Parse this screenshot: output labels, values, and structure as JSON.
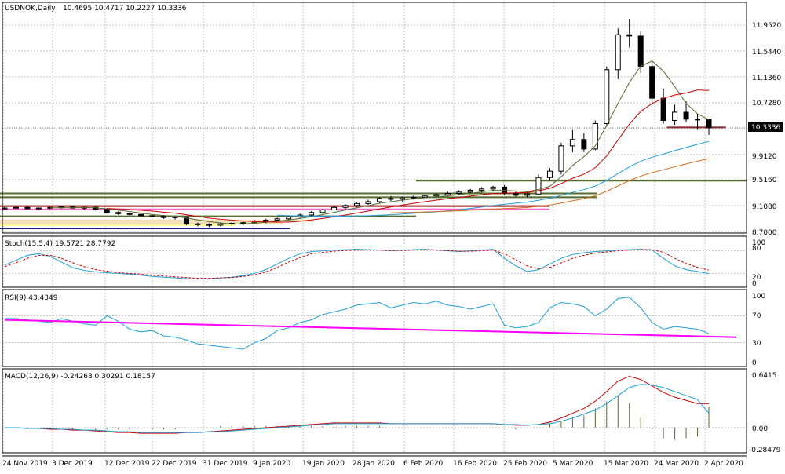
{
  "colors": {
    "bull": "#ffffff",
    "bear": "#000000",
    "grid": "#c0c0c0",
    "frame": "#000000",
    "ma_fast": "#556b2f",
    "ma_mid": "#cc0000",
    "ma_slow": "#1e9ed6",
    "ma_long": "#d2691e",
    "stoch_main": "#1e9ed6",
    "stoch_signal": "#cc0000",
    "rsi": "#1e9ed6",
    "rsi_ma": "#ff00ff",
    "macd_hist": "#556b2f",
    "macd_main": "#cc0000",
    "macd_signal": "#1e9ed6",
    "price_line": "#708090"
  },
  "main": {
    "symbol": "USDNOK,Daily",
    "ohlc": "10.4695 10.4717 10.2227 10.3336",
    "current_price": "10.3336",
    "ticks": [
      "11.9520",
      "11.5440",
      "11.1360",
      "10.7280",
      "9.9120",
      "9.5160",
      "9.1080",
      "8.7000"
    ]
  },
  "stoch": {
    "title": "Stoch(15,5,4) 19.5721 28.7792",
    "top": "100",
    "ticks": [
      "80",
      "20",
      "0"
    ]
  },
  "rsi": {
    "title": "RSI(9) 43.4349",
    "ticks": [
      "100",
      "70",
      "30",
      "0"
    ]
  },
  "macd": {
    "title": "MACD(12,26,9) -0.24268 0.30291 0.18157",
    "ticks": [
      "0.6415",
      "0.00",
      "-0.28479"
    ]
  },
  "x_labels": [
    "24 Nov 2019",
    "3 Dec 2019",
    "12 Dec 2019",
    "22 Dec 2019",
    "31 Dec 2019",
    "9 Jan 2020",
    "19 Jan 2020",
    "28 Jan 2020",
    "6 Feb 2020",
    "16 Feb 2020",
    "25 Feb 2020",
    "5 Mar 2020",
    "15 Mar 2020",
    "24 Mar 2020",
    "2 Apr 2020"
  ],
  "chart_data": {
    "type": "candlestick",
    "instrument": "USDNOK",
    "timeframe": "Daily",
    "price_ticks": [
      11.952,
      11.544,
      11.136,
      10.728,
      9.912,
      9.516,
      9.108,
      8.7
    ],
    "ohlc": [
      [
        9.06,
        9.09,
        9.04,
        9.07
      ],
      [
        9.07,
        9.09,
        9.05,
        9.08
      ],
      [
        9.08,
        9.1,
        9.05,
        9.06
      ],
      [
        9.06,
        9.08,
        9.04,
        9.07
      ],
      [
        9.07,
        9.09,
        9.05,
        9.08
      ],
      [
        9.08,
        9.1,
        9.06,
        9.09
      ],
      [
        9.09,
        9.11,
        9.06,
        9.07
      ],
      [
        9.07,
        9.09,
        9.04,
        9.08
      ],
      [
        9.08,
        9.09,
        9.03,
        9.05
      ],
      [
        9.05,
        9.06,
        8.98,
        9.0
      ],
      [
        9.0,
        9.02,
        8.96,
        8.98
      ],
      [
        8.98,
        9.0,
        8.95,
        8.97
      ],
      [
        8.97,
        8.98,
        8.93,
        8.95
      ],
      [
        8.95,
        8.96,
        8.92,
        8.94
      ],
      [
        8.94,
        8.96,
        8.9,
        8.92
      ],
      [
        8.92,
        8.94,
        8.89,
        8.93
      ],
      [
        8.93,
        8.94,
        8.8,
        8.82
      ],
      [
        8.82,
        8.84,
        8.78,
        8.81
      ],
      [
        8.81,
        8.83,
        8.77,
        8.8
      ],
      [
        8.8,
        8.83,
        8.78,
        8.82
      ],
      [
        8.82,
        8.85,
        8.79,
        8.83
      ],
      [
        8.83,
        8.86,
        8.8,
        8.84
      ],
      [
        8.84,
        8.88,
        8.82,
        8.86
      ],
      [
        8.86,
        8.9,
        8.83,
        8.88
      ],
      [
        8.88,
        8.92,
        8.86,
        8.9
      ],
      [
        8.9,
        8.95,
        8.88,
        8.93
      ],
      [
        8.93,
        8.98,
        8.91,
        8.96
      ],
      [
        8.96,
        9.02,
        8.94,
        9.0
      ],
      [
        9.0,
        9.06,
        8.98,
        9.04
      ],
      [
        9.04,
        9.1,
        9.02,
        9.08
      ],
      [
        9.08,
        9.13,
        9.05,
        9.11
      ],
      [
        9.11,
        9.16,
        9.08,
        9.14
      ],
      [
        9.14,
        9.2,
        9.12,
        9.17
      ],
      [
        9.17,
        9.24,
        9.14,
        9.22
      ],
      [
        9.22,
        9.26,
        9.18,
        9.21
      ],
      [
        9.21,
        9.25,
        9.17,
        9.23
      ],
      [
        9.23,
        9.27,
        9.2,
        9.24
      ],
      [
        9.24,
        9.28,
        9.2,
        9.26
      ],
      [
        9.26,
        9.3,
        9.23,
        9.28
      ],
      [
        9.28,
        9.33,
        9.25,
        9.3
      ],
      [
        9.3,
        9.35,
        9.27,
        9.32
      ],
      [
        9.32,
        9.37,
        9.29,
        9.35
      ],
      [
        9.35,
        9.4,
        9.31,
        9.37
      ],
      [
        9.37,
        9.42,
        9.33,
        9.4
      ],
      [
        9.4,
        9.43,
        9.27,
        9.3
      ],
      [
        9.3,
        9.33,
        9.25,
        9.27
      ],
      [
        9.27,
        9.32,
        9.24,
        9.29
      ],
      [
        9.29,
        9.6,
        9.28,
        9.55
      ],
      [
        9.55,
        9.7,
        9.5,
        9.65
      ],
      [
        9.65,
        10.1,
        9.6,
        10.05
      ],
      [
        10.05,
        10.3,
        9.95,
        10.15
      ],
      [
        10.15,
        10.25,
        9.95,
        10.0
      ],
      [
        10.0,
        10.45,
        9.98,
        10.4
      ],
      [
        10.4,
        11.3,
        10.35,
        11.25
      ],
      [
        11.25,
        11.9,
        11.1,
        11.8
      ],
      [
        11.8,
        12.05,
        11.6,
        11.78
      ],
      [
        11.78,
        11.85,
        11.2,
        11.3
      ],
      [
        11.3,
        11.4,
        10.7,
        10.8
      ],
      [
        10.8,
        10.95,
        10.4,
        10.45
      ],
      [
        10.45,
        10.7,
        10.38,
        10.58
      ],
      [
        10.58,
        10.75,
        10.42,
        10.47
      ],
      [
        10.47,
        10.55,
        10.3,
        10.4695
      ],
      [
        10.4695,
        10.4717,
        10.2227,
        10.3336
      ]
    ],
    "moving_averages": [
      {
        "name": "",
        "color": "#556b2f",
        "last": 10.55
      },
      {
        "name": "",
        "color": "#cc0000",
        "last": 10.85
      },
      {
        "name": "",
        "color": "#1e9ed6",
        "last": 9.85
      },
      {
        "name": "",
        "color": "#d2691e",
        "last": 9.66
      }
    ],
    "indicators": {
      "stochastic": {
        "params": "15,5,4",
        "main": 19.5721,
        "signal": 28.7792,
        "levels": [
          80,
          20
        ],
        "range": [
          0,
          100
        ]
      },
      "rsi": {
        "period": 9,
        "value": 43.4349,
        "levels": [
          70,
          30
        ],
        "range": [
          0,
          100
        ]
      },
      "macd": {
        "params": "12,26,9",
        "histogram": -0.24268,
        "main": 0.30291,
        "signal": 0.18157,
        "range": [
          -0.28479,
          0.6415
        ]
      }
    }
  }
}
